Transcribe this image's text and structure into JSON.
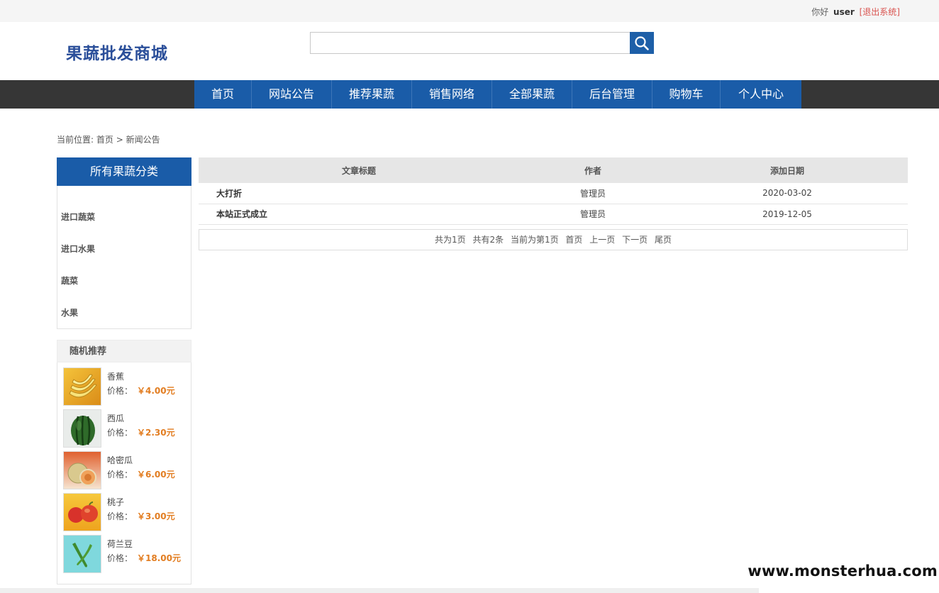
{
  "topbar": {
    "hello": "你好",
    "username": "user",
    "logout": "[退出系统]"
  },
  "header": {
    "logo": "果蔬批发商城",
    "search_placeholder": ""
  },
  "nav": [
    {
      "label": "首页"
    },
    {
      "label": "网站公告"
    },
    {
      "label": "推荐果蔬"
    },
    {
      "label": "销售网络"
    },
    {
      "label": "全部果蔬"
    },
    {
      "label": "后台管理"
    },
    {
      "label": "购物车"
    },
    {
      "label": "个人中心"
    }
  ],
  "breadcrumb": {
    "prefix": "当前位置:",
    "home": "首页",
    "sep": ">",
    "current": "新闻公告"
  },
  "categories": {
    "title": "所有果蔬分类",
    "items": [
      "进口蔬菜",
      "进口水果",
      "蔬菜",
      "水果"
    ]
  },
  "recommend": {
    "title": "随机推荐",
    "price_label": "价格：",
    "items": [
      {
        "name": "香蕉",
        "price": "￥4.00元"
      },
      {
        "name": "西瓜",
        "price": "￥2.30元"
      },
      {
        "name": "哈密瓜",
        "price": "￥6.00元"
      },
      {
        "name": "桃子",
        "price": "￥3.00元"
      },
      {
        "name": "荷兰豆",
        "price": "￥18.00元"
      }
    ]
  },
  "news_table": {
    "headers": [
      "文章标题",
      "作者",
      "添加日期"
    ],
    "rows": [
      [
        "大打折",
        "管理员",
        "2020-03-02"
      ],
      [
        "本站正式成立",
        "管理员",
        "2019-12-05"
      ]
    ]
  },
  "pager": {
    "total_pages": "共为1页",
    "total_items": "共有2条",
    "current": "当前为第1页",
    "first": "首页",
    "prev": "上一页",
    "next": "下一页",
    "last": "尾页"
  },
  "watermark": "www.monsterhua.com",
  "colors": {
    "nav_blue": "#1a5ca8",
    "nav_bar": "#363636",
    "price": "#e27d21",
    "logout": "#d9534f"
  },
  "icons": {
    "search": "search-icon"
  }
}
